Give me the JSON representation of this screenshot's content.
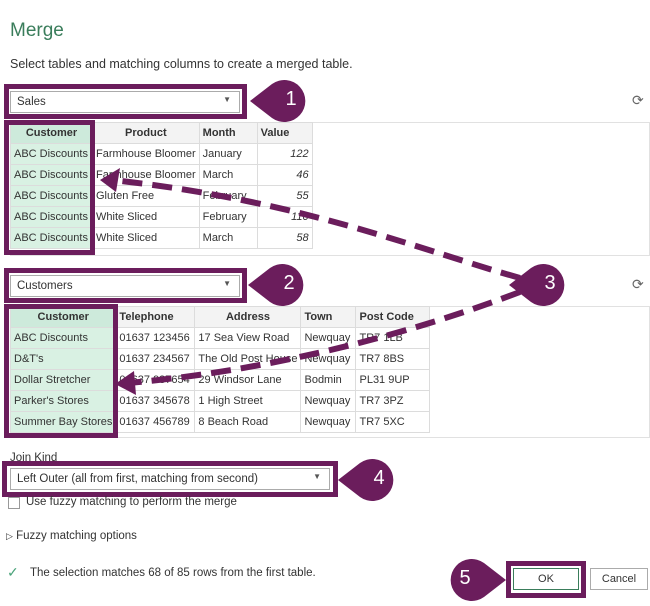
{
  "dialog": {
    "title": "Merge",
    "subtitle": "Select tables and matching columns to create a merged table."
  },
  "first_table": {
    "selected": "Sales",
    "columns": [
      "Customer",
      "Product",
      "Month",
      "Value"
    ],
    "rows": [
      [
        "ABC Discounts",
        "Farmhouse Bloomer",
        "January",
        "122"
      ],
      [
        "ABC Discounts",
        "Farmhouse Bloomer",
        "March",
        "46"
      ],
      [
        "ABC Discounts",
        "Gluten Free",
        "February",
        "55"
      ],
      [
        "ABC Discounts",
        "White Sliced",
        "February",
        "110"
      ],
      [
        "ABC Discounts",
        "White Sliced",
        "March",
        "58"
      ]
    ]
  },
  "second_table": {
    "selected": "Customers",
    "columns": [
      "Customer",
      "Telephone",
      "Address",
      "Town",
      "Post Code"
    ],
    "rows": [
      [
        "ABC Discounts",
        "01637 123456",
        "17 Sea View Road",
        "Newquay",
        "TR7 1LB"
      ],
      [
        "D&T's",
        "01637 234567",
        "The Old Post House",
        "Newquay",
        "TR7 8BS"
      ],
      [
        "Dollar Stretcher",
        "01637 987654",
        "29 Windsor Lane",
        "Bodmin",
        "PL31 9UP"
      ],
      [
        "Parker's Stores",
        "01637 345678",
        "1 High Street",
        "Newquay",
        "TR7 3PZ"
      ],
      [
        "Summer Bay Stores",
        "01637 456789",
        "8 Beach Road",
        "Newquay",
        "TR7 5XC"
      ]
    ]
  },
  "join": {
    "label": "Join Kind",
    "selected": "Left Outer (all from first, matching from second)"
  },
  "fuzzy": {
    "checkbox_label": "Use fuzzy matching to perform the merge",
    "checked": false,
    "options_label": "Fuzzy matching options"
  },
  "status": {
    "icon": "checkmark-icon",
    "text": "The selection matches 68 of 85 rows from the first table."
  },
  "buttons": {
    "ok": "OK",
    "cancel": "Cancel"
  },
  "callouts": [
    "1",
    "2",
    "3",
    "4",
    "5"
  ],
  "colors": {
    "accent": "#6b1d5c",
    "title": "#3a7d5b",
    "selected_column": "#d9f1e3"
  }
}
